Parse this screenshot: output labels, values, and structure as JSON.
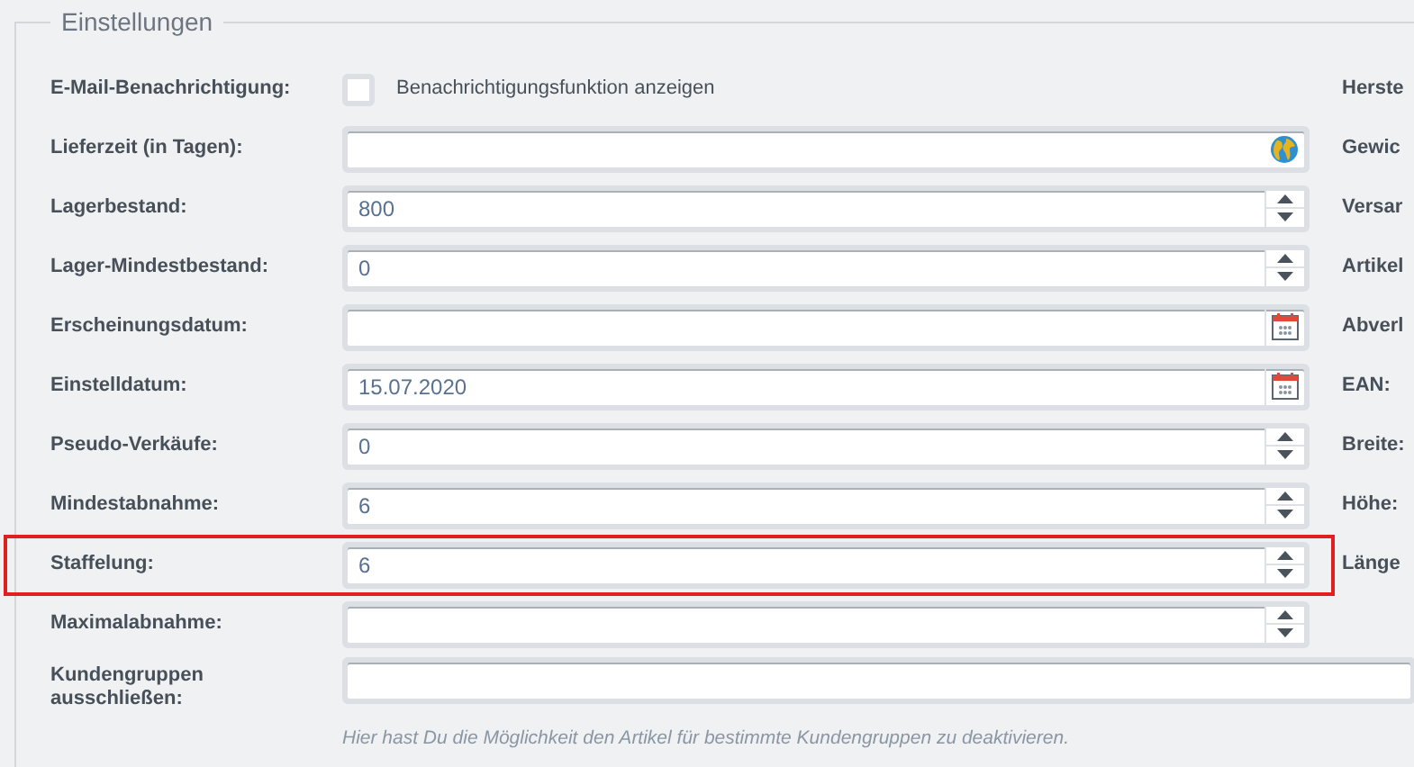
{
  "section": {
    "legend": "Einstellungen"
  },
  "fields": [
    {
      "kind": "checkbox",
      "label": "E-Mail-Benachrichtigung:",
      "checked": false,
      "text": "Benachrichtigungsfunktion anzeigen",
      "highlighted": false
    },
    {
      "kind": "globe",
      "label": "Lieferzeit (in Tagen):",
      "highlighted": false
    },
    {
      "kind": "spinner",
      "label": "Lagerbestand:",
      "value": "800",
      "highlighted": false
    },
    {
      "kind": "spinner",
      "label": "Lager-Mindestbestand:",
      "value": "0",
      "highlighted": false
    },
    {
      "kind": "date",
      "label": "Erscheinungsdatum:",
      "highlighted": false
    },
    {
      "kind": "date",
      "label": "Einstelldatum:",
      "value": "15.07.2020",
      "highlighted": false
    },
    {
      "kind": "spinner",
      "label": "Pseudo-Verkäufe:",
      "value": "0",
      "highlighted": false
    },
    {
      "kind": "spinner",
      "label": "Mindestabnahme:",
      "value": "6",
      "highlighted": false
    },
    {
      "kind": "spinner",
      "label": "Staffelung:",
      "value": "6",
      "highlighted": true
    },
    {
      "kind": "spinner",
      "label": "Maximalabnahme:",
      "highlighted": false
    }
  ],
  "right_labels": [
    "Herste",
    "Gewic",
    "Versar",
    "Artikel",
    "Abverl",
    "EAN:",
    "Breite:",
    "Höhe:",
    "Länge"
  ],
  "customer_groups": {
    "label": "Kundengruppen ausschließen:",
    "hint": "Hier hast Du die Möglichkeit den Artikel für bestimmte Kundengruppen zu deaktivieren."
  }
}
